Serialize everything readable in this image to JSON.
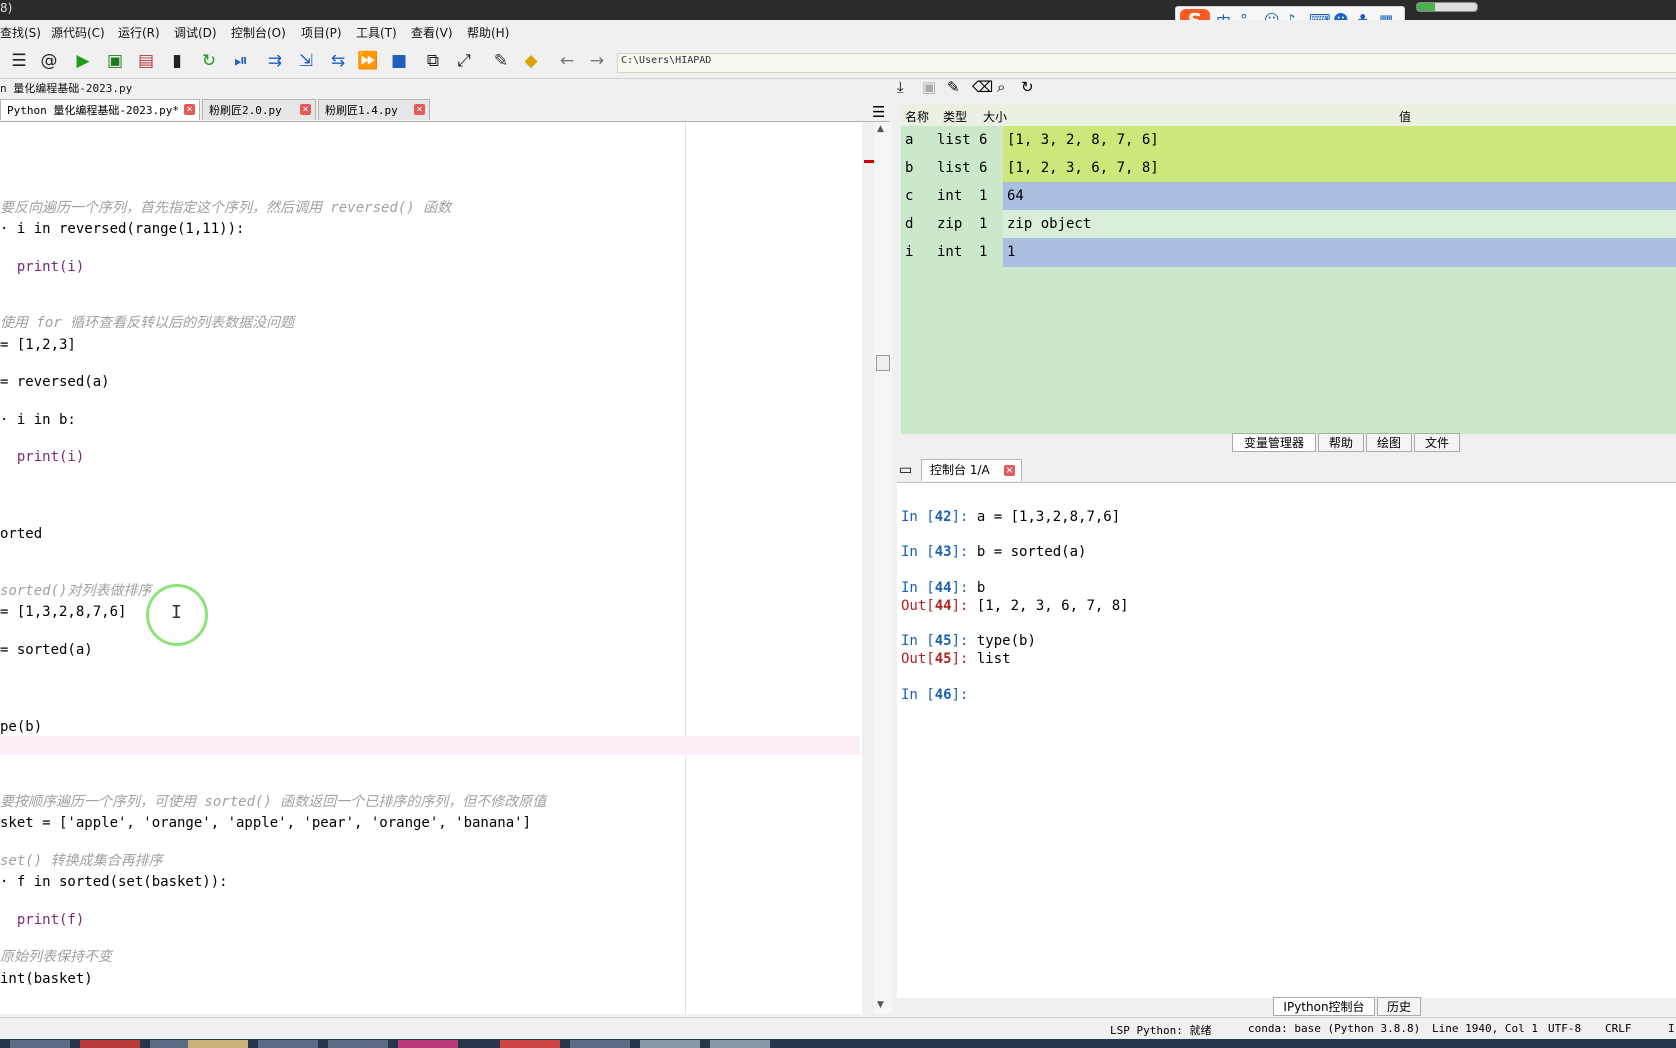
{
  "window_title_fragment": "8)",
  "menu": [
    "查找(S)",
    "源代码(C)",
    "运行(R)",
    "调试(D)",
    "控制台(O)",
    "项目(P)",
    "工具(T)",
    "查看(V)",
    "帮助(H)"
  ],
  "ime": {
    "logo": "S",
    "lang": "中",
    "punct": "°,",
    "icons": [
      "emoji-icon",
      "mic-icon",
      "keyboard-icon",
      "user-icon",
      "skin-icon",
      "grid-icon"
    ]
  },
  "toolbar": {
    "path": "C:\\Users\\HIAPAD",
    "icons": [
      "outline-icon",
      "at-icon",
      "run-icon",
      "run-cell-icon",
      "run-cell-advance-icon",
      "run-selection-icon",
      "rerun-icon",
      "debug-icon",
      "step-icon",
      "step-into-icon",
      "step-return-icon",
      "continue-icon",
      "stop-icon",
      "maximize-pane-icon",
      "fullscreen-icon",
      "preferences-icon",
      "python-path-icon",
      "back-icon",
      "forward-icon"
    ]
  },
  "editor": {
    "file_label": "n 量化编程基础-2023.py",
    "tabs": [
      {
        "label": "Python 量化编程基础-2023.py*",
        "active": true
      },
      {
        "label": "粉刷匠2.0.py",
        "active": false
      },
      {
        "label": "粉刷匠1.4.py",
        "active": false
      }
    ],
    "close_glyph": "×",
    "cursor_glyph": "I",
    "lines": [
      {
        "text": "要反向遍历一个序列，首先指定这个序列，然后调用 reversed() 函数",
        "kind": "comment"
      },
      {
        "text": "· i in reversed(range(1,11)):",
        "kind": "code"
      },
      {
        "text": "  print(i)",
        "kind": "code"
      },
      {
        "text": "使用 for 循环查看反转以后的列表数据没问题",
        "kind": "comment"
      },
      {
        "text": "= [1,2,3]",
        "kind": "code"
      },
      {
        "text": "= reversed(a)",
        "kind": "code"
      },
      {
        "text": "· i in b:",
        "kind": "code"
      },
      {
        "text": "  print(i)",
        "kind": "code"
      },
      {
        "text": "orted",
        "kind": "code"
      },
      {
        "text": "sorted()对列表做排序",
        "kind": "comment"
      },
      {
        "text": "= [1,3,2,8,7,6]",
        "kind": "code"
      },
      {
        "text": "= sorted(a)",
        "kind": "code"
      },
      {
        "text": "pe(b)",
        "kind": "code"
      },
      {
        "text": "要按顺序遍历一个序列，可使用 sorted() 函数返回一个已排序的序列，但不修改原值",
        "kind": "comment"
      },
      {
        "text": "sket = ['apple', 'orange', 'apple', 'pear', 'orange', 'banana']",
        "kind": "code"
      },
      {
        "text": "set() 转换成集合再排序",
        "kind": "comment"
      },
      {
        "text": "· f in sorted(set(basket)):",
        "kind": "code"
      },
      {
        "text": "  print(f)",
        "kind": "code"
      },
      {
        "text": "原始列表保持不变",
        "kind": "comment"
      },
      {
        "text": "int(basket)",
        "kind": "code"
      }
    ]
  },
  "variable_explorer": {
    "headers": {
      "name": "名称",
      "type": "类型",
      "size": "大小",
      "value": "值"
    },
    "rows": [
      {
        "name": "a",
        "type": "list",
        "size": "6",
        "value": "[1, 3, 2, 8, 7, 6]",
        "color": "#cde87a"
      },
      {
        "name": "b",
        "type": "list",
        "size": "6",
        "value": "[1, 2, 3, 6, 7, 8]",
        "color": "#cde87a"
      },
      {
        "name": "c",
        "type": "int",
        "size": "1",
        "value": "64",
        "color": "#a9bfdf"
      },
      {
        "name": "d",
        "type": "zip",
        "size": "1",
        "value": "zip object",
        "color": "#d8eed8"
      },
      {
        "name": "i",
        "type": "int",
        "size": "1",
        "value": "1",
        "color": "#a9bfdf"
      }
    ],
    "pane_tabs": [
      "变量管理器",
      "帮助",
      "绘图",
      "文件"
    ]
  },
  "console": {
    "tab_label": "控制台 1/A",
    "lines": [
      {
        "prefix": "In [",
        "num": "42",
        "suffix": "]: ",
        "text": "a = [1,3,2,8,7,6]",
        "kind": "in"
      },
      {
        "prefix": "In [",
        "num": "43",
        "suffix": "]: ",
        "text": "b = sorted(a)",
        "kind": "in"
      },
      {
        "prefix": "In [",
        "num": "44",
        "suffix": "]: ",
        "text": "b",
        "kind": "in"
      },
      {
        "prefix": "Out[",
        "num": "44",
        "suffix": "]: ",
        "text": "[1, 2, 3, 6, 7, 8]",
        "kind": "out"
      },
      {
        "prefix": "In [",
        "num": "45",
        "suffix": "]: ",
        "text": "type(b)",
        "kind": "in"
      },
      {
        "prefix": "Out[",
        "num": "45",
        "suffix": "]: ",
        "text": "list",
        "kind": "out"
      },
      {
        "prefix": "In [",
        "num": "46",
        "suffix": "]: ",
        "text": "",
        "kind": "in"
      }
    ],
    "bottom_tabs": [
      "IPython控制台",
      "历史"
    ]
  },
  "status": {
    "lsp": "LSP Python: 就绪",
    "conda": "conda: base (Python 3.8.8)",
    "position": "Line 1940, Col 1",
    "encoding": "UTF-8",
    "eol": "CRLF",
    "extra": "I"
  },
  "progress_fraction": 0.3
}
